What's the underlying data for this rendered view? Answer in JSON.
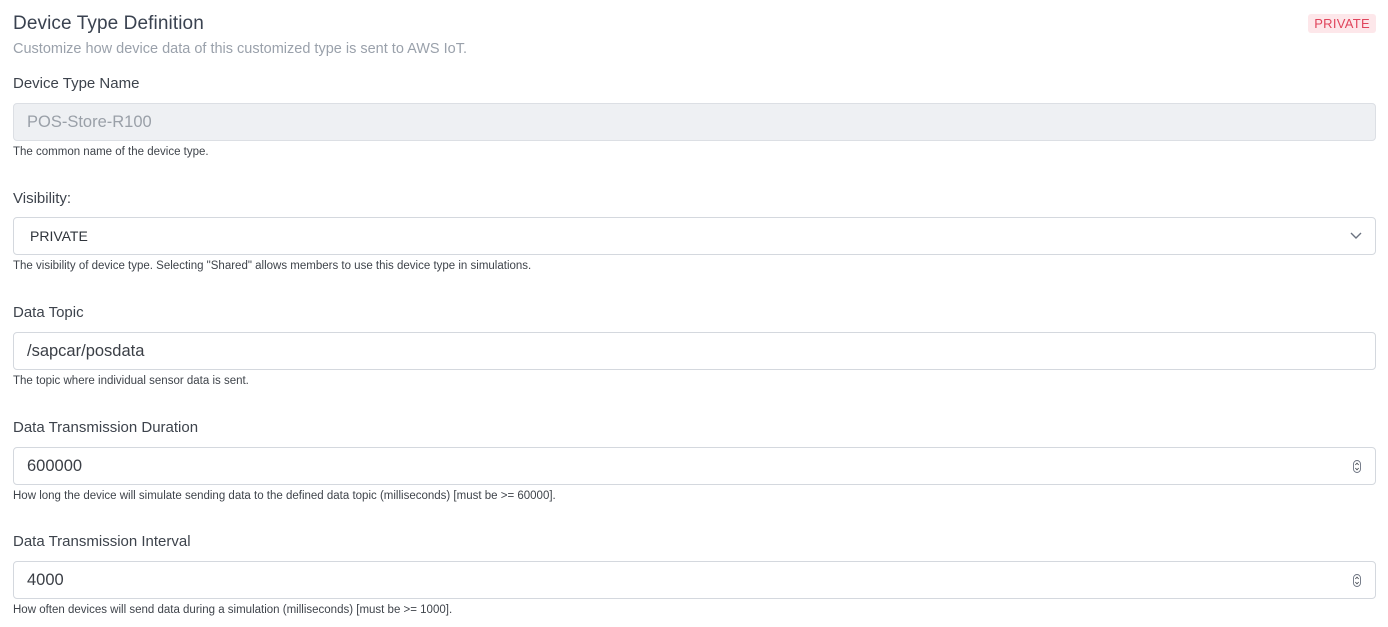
{
  "header": {
    "title": "Device Type Definition",
    "subtitle": "Customize how device data of this customized type is sent to AWS IoT.",
    "badge": "PRIVATE"
  },
  "fields": {
    "device_type_name": {
      "label": "Device Type Name",
      "value": "POS-Store-R100",
      "help": "The common name of the device type."
    },
    "visibility": {
      "label": "Visibility:",
      "value": "PRIVATE",
      "help": "The visibility of device type. Selecting \"Shared\" allows members to use this device type in simulations."
    },
    "data_topic": {
      "label": "Data Topic",
      "value": "/sapcar/posdata",
      "help": "The topic where individual sensor data is sent."
    },
    "transmission_duration": {
      "label": "Data Transmission Duration",
      "value": "600000",
      "help": "How long the device will simulate sending data to the defined data topic (milliseconds) [must be >= 60000]."
    },
    "transmission_interval": {
      "label": "Data Transmission Interval",
      "value": "4000",
      "help": "How often devices will send data during a simulation (milliseconds) [must be >= 1000]."
    }
  },
  "colors": {
    "badge_bg": "#fde7ea",
    "badge_text": "#e0455c",
    "border": "#d4d8de",
    "disabled_bg": "#eef0f3"
  },
  "icons": {
    "select": "chevron-down-icon",
    "number": "spinner-arrows-icon"
  }
}
